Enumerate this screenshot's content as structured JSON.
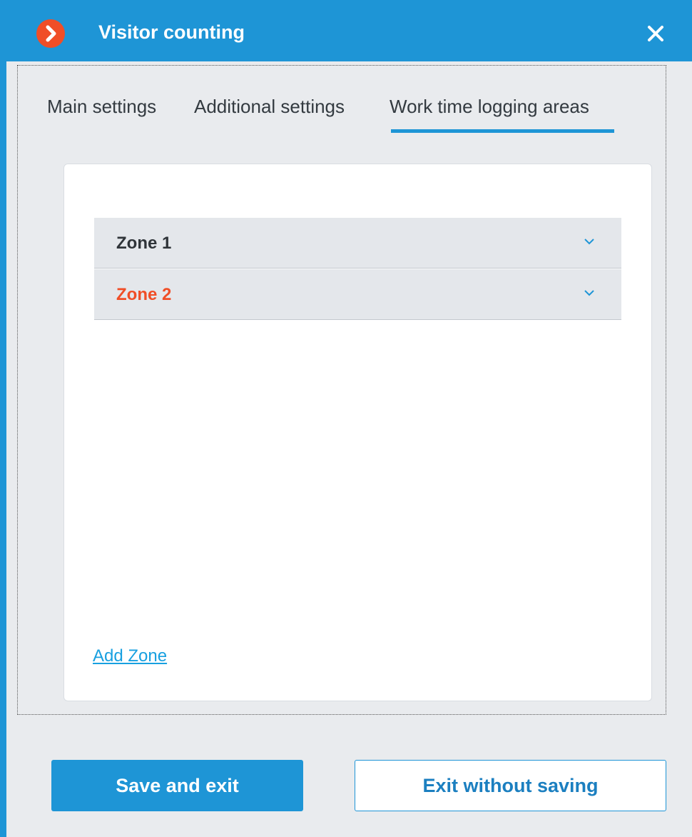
{
  "window": {
    "title": "Visitor counting",
    "app_icon": "chevron-right-icon",
    "close_icon": "close-icon"
  },
  "tabs": [
    {
      "label": "Main settings",
      "active": false
    },
    {
      "label": "Additional settings",
      "active": false
    },
    {
      "label": "Work time logging areas",
      "active": true
    }
  ],
  "zones": [
    {
      "label": "Zone 1",
      "color": "#2f3439",
      "icon": "chevron-down-icon"
    },
    {
      "label": "Zone 2",
      "color": "#f04e27",
      "icon": "chevron-down-icon"
    }
  ],
  "add_zone_label": "Add Zone",
  "buttons": {
    "save": "Save and exit",
    "exit": "Exit without saving"
  },
  "colors": {
    "accent": "#1e95d6",
    "error": "#f04e27",
    "link": "#18a0e0"
  }
}
